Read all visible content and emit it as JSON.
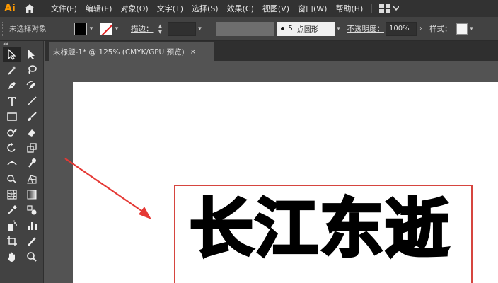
{
  "app": {
    "logo": "Ai"
  },
  "menubar": {
    "items": [
      "文件(F)",
      "编辑(E)",
      "对象(O)",
      "文字(T)",
      "选择(S)",
      "效果(C)",
      "视图(V)",
      "窗口(W)",
      "帮助(H)"
    ]
  },
  "control": {
    "selection_status": "未选择对象",
    "stroke_label": "描边：",
    "brush_size": "5",
    "brush_name": "点圆形",
    "opacity_label": "不透明度：",
    "opacity_value": "100%",
    "style_label": "样式："
  },
  "document": {
    "tab_title": "未标题-1* @ 125% (CMYK/GPU 预览)",
    "close_glyph": "×"
  },
  "canvas": {
    "text_content": "长江东逝"
  },
  "colors": {
    "fill": "#000000",
    "stroke_none_slash": "#e02020",
    "frame_border": "#d6453f",
    "arrow": "#e53935",
    "logo": "#ff9a00"
  },
  "tools": [
    "selection-tool-icon",
    "direct-selection-tool-icon",
    "magic-wand-tool-icon",
    "lasso-tool-icon",
    "pen-tool-icon",
    "curvature-tool-icon",
    "type-tool-icon",
    "line-segment-tool-icon",
    "rectangle-tool-icon",
    "paintbrush-tool-icon",
    "shaper-tool-icon",
    "eraser-tool-icon",
    "rotate-tool-icon",
    "scale-tool-icon",
    "width-tool-icon",
    "puppet-warp-tool-icon",
    "shape-builder-tool-icon",
    "perspective-grid-tool-icon",
    "mesh-tool-icon",
    "gradient-tool-icon",
    "eyedropper-tool-icon",
    "blend-tool-icon",
    "symbol-sprayer-tool-icon",
    "column-graph-tool-icon",
    "artboard-tool-icon",
    "slice-tool-icon",
    "hand-tool-icon",
    "zoom-tool-icon"
  ]
}
